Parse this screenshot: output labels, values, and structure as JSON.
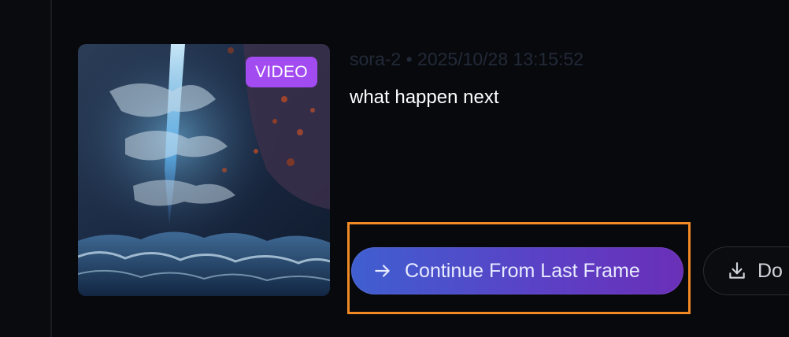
{
  "card": {
    "badge": "VIDEO",
    "meta": "sora-2 • 2025/10/28 13:15:52",
    "prompt": "what happen next",
    "thumbnail": "stormy-ocean-lightning-thumbnail"
  },
  "actions": {
    "continue_label": "Continue From Last Frame",
    "continue_icon": "arrow-right-icon",
    "download_label": "Do",
    "download_icon": "download-icon"
  },
  "colors": {
    "background": "#08090d",
    "badge": "#a24bf0",
    "highlight": "#f08a24",
    "button_gradient_start": "#3f5fd0",
    "button_gradient_end": "#6a2fb8"
  }
}
